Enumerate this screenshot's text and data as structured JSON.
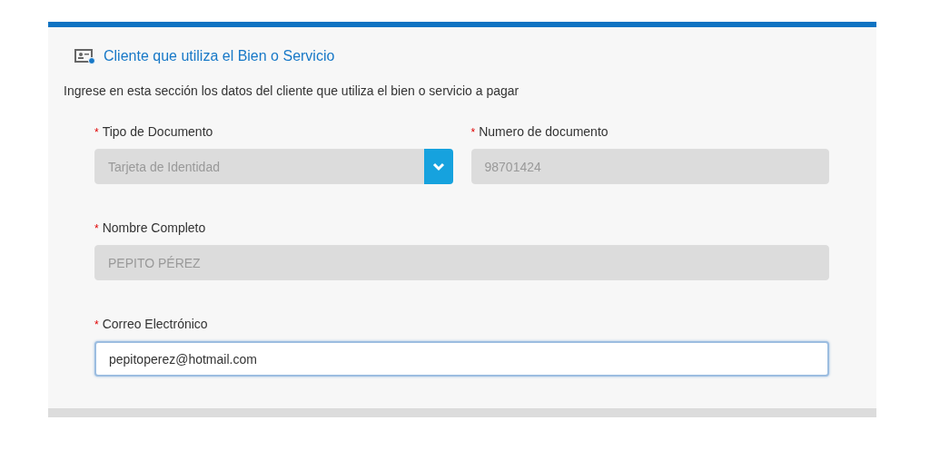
{
  "section": {
    "title": "Cliente que utiliza el Bien o Servicio",
    "description": "Ingrese en esta sección los datos del cliente que utiliza el bien o servicio a pagar"
  },
  "rows": [
    {
      "fields": [
        {
          "kind": "select",
          "required_mark": "*",
          "label": "Tipo de Documento",
          "value": "Tarjeta de Identidad",
          "disabled": true,
          "focused": false
        },
        {
          "kind": "text",
          "required_mark": "*",
          "label": "Numero de documento",
          "value": "98701424",
          "disabled": true,
          "focused": false
        }
      ]
    },
    {
      "fields": [
        {
          "kind": "text",
          "required_mark": "*",
          "label": "Nombre Completo",
          "value": "PEPITO PÉREZ",
          "disabled": true,
          "focused": false
        }
      ]
    },
    {
      "fields": [
        {
          "kind": "text",
          "required_mark": "*",
          "label": "Correo Electrónico",
          "value": "pepitoperez@hotmail.com",
          "disabled": false,
          "focused": true
        }
      ]
    }
  ]
}
